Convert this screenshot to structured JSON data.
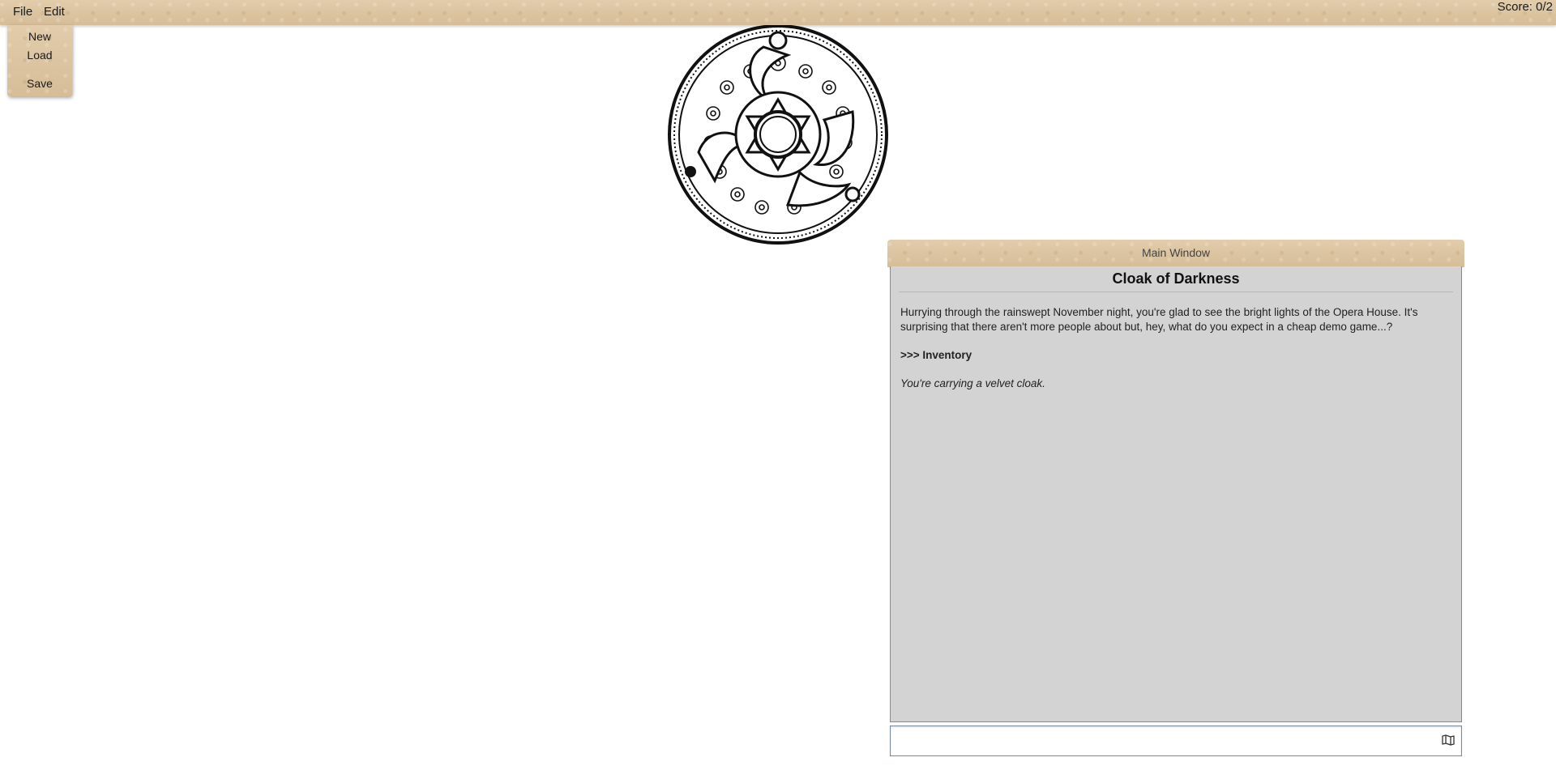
{
  "menubar": {
    "file_label": "File",
    "edit_label": "Edit",
    "score": "Score: 0/2"
  },
  "file_menu": {
    "items": [
      "New",
      "Load",
      "Save"
    ]
  },
  "medallion": {
    "icon": "ornamental-medallion-icon"
  },
  "main_window": {
    "header": "Main Window",
    "title": "Cloak of Darkness",
    "paragraphs": {
      "intro": "Hurrying through the rainswept November night, you're glad to see the bright lights of the Opera House. It's surprising that there aren't more people about but, hey, what do you expect in a cheap demo game...?",
      "command": ">>> Inventory",
      "response": "You're carrying a velvet cloak."
    },
    "input": {
      "value": "",
      "placeholder": ""
    },
    "map_icon": "map-icon"
  },
  "colors": {
    "parchment": "#dcc5a4",
    "panel_bg": "#d3d3d3"
  }
}
